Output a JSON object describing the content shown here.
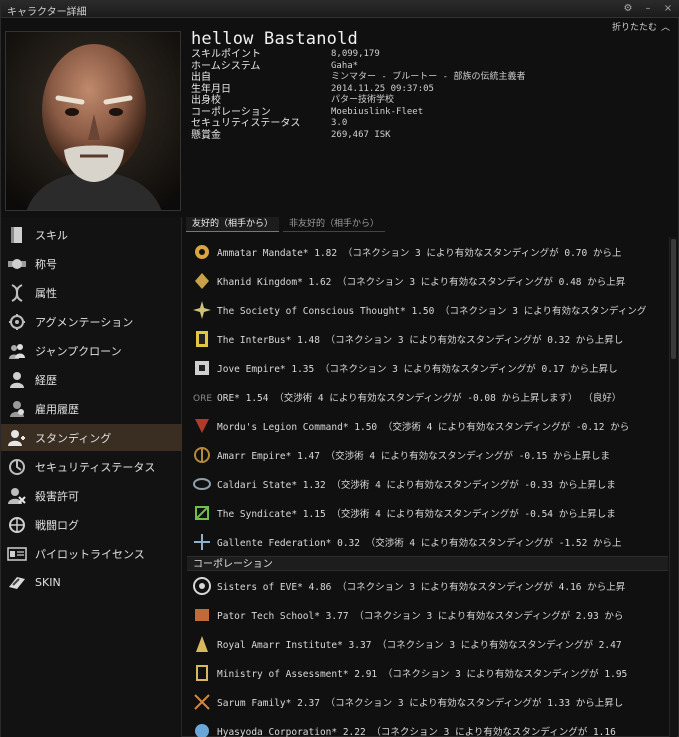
{
  "window": {
    "title": "キャラクター詳細"
  },
  "header": {
    "name": "hellow Bastanold",
    "collapse_label": "折りたたむ",
    "rows": [
      {
        "label": "スキルポイント",
        "value": "8,099,179"
      },
      {
        "label": "ホームシステム",
        "value": "Gaha*"
      },
      {
        "label": "出自",
        "value": "ミンマター - ブルートー - 部族の伝統主義者"
      },
      {
        "label": "生年月日",
        "value": "2014.11.25 09:37:05"
      },
      {
        "label": "出身校",
        "value": "パター技術学校"
      },
      {
        "label": "コーポレーション",
        "value": "Moebiuslink-Fleet"
      },
      {
        "label": "セキュリティステータス",
        "value": "3.0"
      },
      {
        "label": "懸賞金",
        "value": "269,467 ISK"
      }
    ]
  },
  "sidebar": {
    "items": [
      {
        "label": "スキル",
        "icon": "skill-book-icon"
      },
      {
        "label": "称号",
        "icon": "decoration-icon"
      },
      {
        "label": "属性",
        "icon": "dna-icon"
      },
      {
        "label": "アグメンテーション",
        "icon": "implant-icon"
      },
      {
        "label": "ジャンプクローン",
        "icon": "clone-icon"
      },
      {
        "label": "経歴",
        "icon": "bio-icon"
      },
      {
        "label": "雇用履歴",
        "icon": "employment-icon"
      },
      {
        "label": "スタンディング",
        "icon": "standings-icon",
        "active": true
      },
      {
        "label": "セキュリティステータス",
        "icon": "security-icon"
      },
      {
        "label": "殺害許可",
        "icon": "kill-rights-icon"
      },
      {
        "label": "戦闘ログ",
        "icon": "combat-log-icon"
      },
      {
        "label": "パイロットライセンス",
        "icon": "license-icon"
      },
      {
        "label": "SKIN",
        "icon": "skin-icon"
      }
    ]
  },
  "tabs": [
    {
      "label": "友好的（相手から）",
      "active": true
    },
    {
      "label": "非友好的（相手から）",
      "active": false
    }
  ],
  "factions": [
    {
      "text": "Ammatar Mandate* 1.82 （コネクション 3 により有効なスタンディングが 0.70 から上",
      "icon": "ammatar-icon",
      "color": "#d9a441"
    },
    {
      "text": "Khanid Kingdom* 1.62 （コネクション 3 により有効なスタンディングが 0.48 から上昇",
      "icon": "khanid-icon",
      "color": "#c8a24a"
    },
    {
      "text": "The Society of Conscious Thought* 1.50 （コネクション 3 により有効なスタンディング",
      "icon": "sot-icon",
      "color": "#d0c27a"
    },
    {
      "text": "The InterBus* 1.48 （コネクション 3 により有効なスタンディングが 0.32 から上昇し",
      "icon": "interbus-icon",
      "color": "#e2c640"
    },
    {
      "text": "Jove Empire* 1.35 （コネクション 3 により有効なスタンディングが 0.17 から上昇し",
      "icon": "jove-icon",
      "color": "#cfcfcf"
    },
    {
      "text": "ORE* 1.54 （交渉術 4 により有効なスタンディングが -0.08 から上昇します） （良好）",
      "icon": "ore-icon",
      "color": "#7a7a7a"
    },
    {
      "text": "Mordu's Legion Command* 1.50 （交渉術 4 により有効なスタンディングが -0.12 から",
      "icon": "mordu-icon",
      "color": "#b03a2a"
    },
    {
      "text": "Amarr Empire* 1.47 （交渉術 4 により有効なスタンディングが -0.15 から上昇しま",
      "icon": "amarr-icon",
      "color": "#b58a3a"
    },
    {
      "text": "Caldari State* 1.32 （交渉術 4 により有効なスタンディングが -0.33 から上昇しま",
      "icon": "caldari-icon",
      "color": "#8ea0aa"
    },
    {
      "text": "The Syndicate* 1.15 （交渉術 4 により有効なスタンディングが -0.54 から上昇しま",
      "icon": "syndicate-icon",
      "color": "#6fbf4a"
    },
    {
      "text": "Gallente Federation* 0.32 （交渉術 4 により有効なスタンディングが -1.52 から上",
      "icon": "gallente-icon",
      "color": "#8fb0c8"
    }
  ],
  "corporation_header": "コーポレーション",
  "corporations": [
    {
      "text": "Sisters of EVE* 4.86 （コネクション 3 により有効なスタンディングが 4.16 から上昇",
      "icon": "soe-icon",
      "color": "#d6d6d6"
    },
    {
      "text": "Pator Tech School* 3.77 （コネクション 3 により有効なスタンディングが 2.93 から",
      "icon": "pator-icon",
      "color": "#c06a3a"
    },
    {
      "text": "Royal Amarr Institute* 3.37 （コネクション 3 により有効なスタンディングが 2.47",
      "icon": "rai-icon",
      "color": "#d9b760"
    },
    {
      "text": "Ministry of Assessment* 2.91 （コネクション 3 により有効なスタンディングが 1.95",
      "icon": "moa-icon",
      "color": "#d9b760"
    },
    {
      "text": "Sarum Family* 2.37 （コネクション 3 により有効なスタンディングが 1.33 から上昇し",
      "icon": "sarum-icon",
      "color": "#d28a3a"
    },
    {
      "text": "Hyasyoda Corporation* 2.22 （コネクション 3 により有効なスタンディングが 1.16",
      "icon": "hyasyoda-icon",
      "color": "#6aa7d8"
    }
  ]
}
